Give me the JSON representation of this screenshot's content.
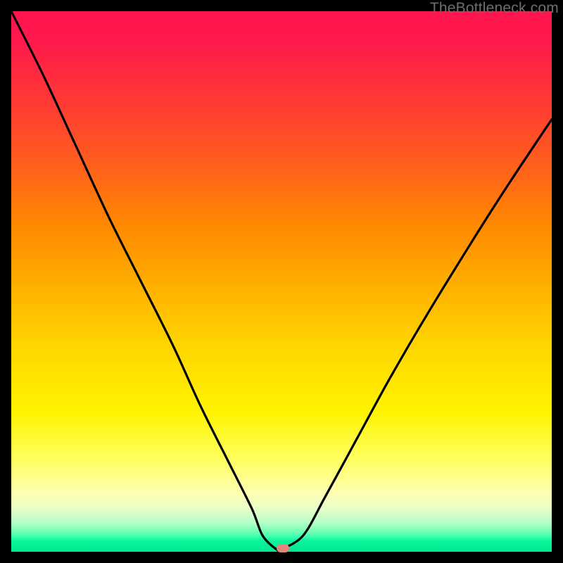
{
  "watermark": "TheBottleneck.com",
  "chart_data": {
    "type": "line",
    "title": "",
    "xlabel": "",
    "ylabel": "",
    "xlim": [
      0,
      100
    ],
    "ylim": [
      0,
      100
    ],
    "grid": false,
    "series": [
      {
        "name": "bottleneck-curve",
        "x": [
          0,
          6,
          12,
          18,
          24,
          30,
          35,
          40,
          44.5,
          46.5,
          49,
          50,
          54,
          58,
          64,
          70,
          77,
          85,
          92,
          100
        ],
        "values": [
          100,
          88,
          75,
          62,
          50,
          38,
          27,
          17,
          8,
          3,
          0.5,
          0.5,
          3,
          10,
          21,
          32,
          44,
          57,
          68,
          80
        ]
      }
    ],
    "marker": {
      "x": 50.2,
      "y": 0.6,
      "color": "#e3847d"
    },
    "background_gradient": {
      "stops": [
        {
          "pct": 0,
          "color": "#ff1450"
        },
        {
          "pct": 40,
          "color": "#ff8a00"
        },
        {
          "pct": 74,
          "color": "#fff300"
        },
        {
          "pct": 92,
          "color": "#e8ffc8"
        },
        {
          "pct": 100,
          "color": "#00e890"
        }
      ]
    }
  }
}
